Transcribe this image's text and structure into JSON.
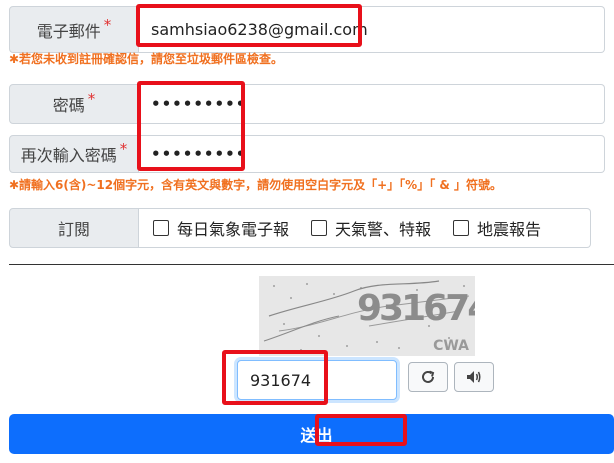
{
  "email": {
    "label": "電子郵件",
    "required_mark": "*",
    "value": "samhsiao6238@gmail.com"
  },
  "email_hint": "✱若您未收到註冊確認信，請您至垃圾郵件區檢查。",
  "password": {
    "label": "密碼",
    "required_mark": "*",
    "value": "•••••••••"
  },
  "password_confirm": {
    "label": "再次輸入密碼",
    "required_mark": "*",
    "value": "•••••••••"
  },
  "password_hint": "✱請輸入6(含)~12個字元，含有英文與數字，請勿使用空白字元及「+」「%」「 & 」符號。",
  "subscribe": {
    "label": "訂閱",
    "options": [
      {
        "label": "每日氣象電子報",
        "checked": false
      },
      {
        "label": "天氣警、特報",
        "checked": false
      },
      {
        "label": "地震報告",
        "checked": false
      }
    ]
  },
  "captcha": {
    "code_image_text": "931674",
    "watermark": "CWA",
    "input_value": "931674"
  },
  "buttons": {
    "refresh_icon": "refresh-icon",
    "audio_icon": "speaker-icon",
    "submit_label": "送出"
  },
  "colors": {
    "highlight": "#e8101a",
    "hint": "#f07020",
    "submit": "#0d6efd"
  }
}
